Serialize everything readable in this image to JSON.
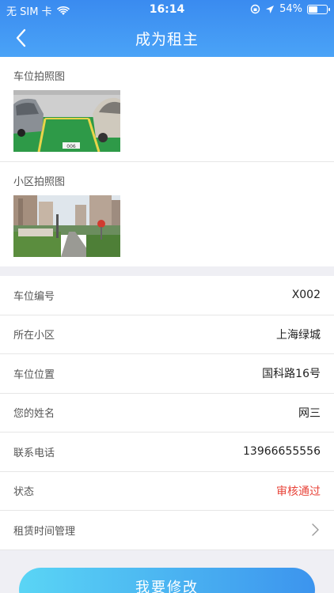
{
  "status_bar": {
    "carrier": "无 SIM 卡",
    "time": "16:14",
    "battery": "54%",
    "battery_level": 0.54
  },
  "nav": {
    "title": "成为租主"
  },
  "photos": [
    {
      "label": "车位拍照图"
    },
    {
      "label": "小区拍照图"
    }
  ],
  "parking_sign_text": "006",
  "rows": [
    {
      "key": "车位编号",
      "value": "X002"
    },
    {
      "key": "所在小区",
      "value": "上海绿城"
    },
    {
      "key": "车位位置",
      "value": "国科路16号"
    },
    {
      "key": "您的姓名",
      "value": "网三"
    },
    {
      "key": "联系电话",
      "value": "13966655556"
    },
    {
      "key": "状态",
      "value": "审核通过"
    },
    {
      "key": "租赁时间管理",
      "value": ""
    }
  ],
  "cta": {
    "label": "我要修改"
  },
  "colors": {
    "accent": "#3a8bf0",
    "status_ok": "#e8443a"
  }
}
